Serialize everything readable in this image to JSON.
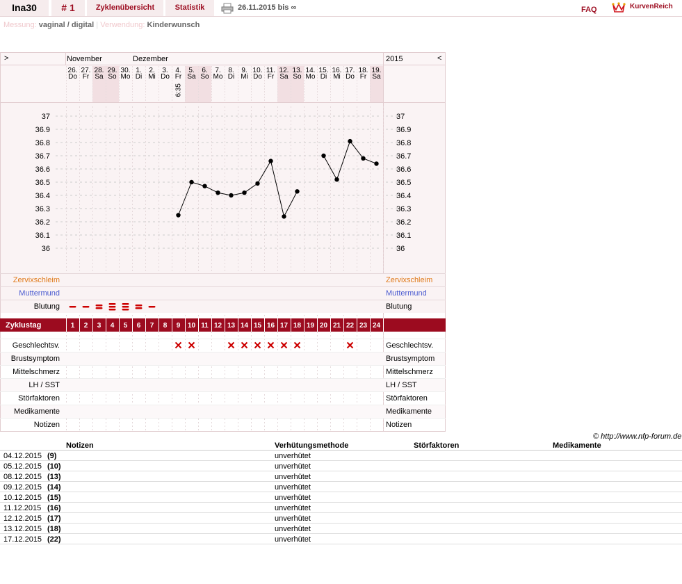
{
  "header": {
    "user": "Ina30",
    "cycle_number": "# 1",
    "tab_cycles": "Zyklenübersicht",
    "tab_stats": "Statistik",
    "date_range": "26.11.2015 bis ∞",
    "faq": "FAQ",
    "brand": "KurvenReich",
    "print_icon": "printer-icon",
    "logo_icon": "crown-logo-icon"
  },
  "meta": {
    "measure_label": "Messung:",
    "measure_value": "vaginal / digital",
    "sep": "|",
    "use_label": "Verwendung:",
    "use_value": "Kinderwunsch"
  },
  "colors": {
    "accent": "#9c0b1f",
    "weekend": "#f2dfe2",
    "cervix_label": "#e07a1a",
    "muttermund_label": "#4a5bd0",
    "bleed": "#cc0000",
    "cross": "#cc0000"
  },
  "chart_data": {
    "type": "line",
    "nav_prev": ">",
    "nav_next": "<",
    "year": "2015",
    "month_labels": [
      {
        "label": "November",
        "at_day": 0
      },
      {
        "label": "Dezember",
        "at_day": 5
      }
    ],
    "days": [
      {
        "d": "26.",
        "w": "Do",
        "we": false
      },
      {
        "d": "27.",
        "w": "Fr",
        "we": false
      },
      {
        "d": "28.",
        "w": "Sa",
        "we": true
      },
      {
        "d": "29.",
        "w": "So",
        "we": true
      },
      {
        "d": "30.",
        "w": "Mo",
        "we": false
      },
      {
        "d": "1.",
        "w": "Di",
        "we": false
      },
      {
        "d": "2.",
        "w": "Mi",
        "we": false
      },
      {
        "d": "3.",
        "w": "Do",
        "we": false
      },
      {
        "d": "4.",
        "w": "Fr",
        "we": false
      },
      {
        "d": "5.",
        "w": "Sa",
        "we": true
      },
      {
        "d": "6.",
        "w": "So",
        "we": true
      },
      {
        "d": "7.",
        "w": "Mo",
        "we": false
      },
      {
        "d": "8.",
        "w": "Di",
        "we": false
      },
      {
        "d": "9.",
        "w": "Mi",
        "we": false
      },
      {
        "d": "10.",
        "w": "Do",
        "we": false
      },
      {
        "d": "11.",
        "w": "Fr",
        "we": false
      },
      {
        "d": "12.",
        "w": "Sa",
        "we": true
      },
      {
        "d": "13.",
        "w": "So",
        "we": true
      },
      {
        "d": "14.",
        "w": "Mo",
        "we": false
      },
      {
        "d": "15.",
        "w": "Di",
        "we": false
      },
      {
        "d": "16.",
        "w": "Mi",
        "we": false
      },
      {
        "d": "17.",
        "w": "Do",
        "we": false
      },
      {
        "d": "18.",
        "w": "Fr",
        "we": false
      },
      {
        "d": "19.",
        "w": "Sa",
        "we": true
      }
    ],
    "time_label": {
      "day_index": 8,
      "text": "6:35"
    },
    "ylim": [
      36.0,
      37.0
    ],
    "yticks": [
      "37",
      "36.9",
      "36.8",
      "36.7",
      "36.6",
      "36.5",
      "36.4",
      "36.3",
      "36.2",
      "36.1",
      "36"
    ],
    "temperatures": [
      null,
      null,
      null,
      null,
      null,
      null,
      null,
      null,
      36.25,
      36.5,
      36.47,
      36.42,
      36.4,
      36.42,
      36.49,
      36.66,
      36.24,
      36.43,
      null,
      36.7,
      36.52,
      36.81,
      36.68,
      36.64
    ],
    "rows_top": [
      "Zervixschleim",
      "Muttermund",
      "Blutung"
    ],
    "bleeding": [
      1,
      1,
      2,
      3,
      3,
      2,
      1,
      0,
      0,
      0,
      0,
      0,
      0,
      0,
      0,
      0,
      0,
      0,
      0,
      0,
      0,
      0,
      0,
      0
    ],
    "cycle_label": "Zyklustag",
    "cycle_days": [
      "1",
      "2",
      "3",
      "4",
      "5",
      "6",
      "7",
      "8",
      "9",
      "10",
      "11",
      "12",
      "13",
      "14",
      "15",
      "16",
      "17",
      "18",
      "19",
      "20",
      "21",
      "22",
      "23",
      "24"
    ],
    "rows_bottom": [
      "Geschlechtsv.",
      "Brustsymptom",
      "Mittelschmerz",
      "LH / SST",
      "Störfaktoren",
      "Medikamente",
      "Notizen"
    ],
    "intercourse": [
      false,
      false,
      false,
      false,
      false,
      false,
      false,
      false,
      true,
      true,
      false,
      false,
      true,
      true,
      true,
      true,
      true,
      true,
      false,
      false,
      false,
      true,
      false,
      false
    ]
  },
  "copyright": "© http://www.nfp-forum.de",
  "notes_table": {
    "headers": [
      "Notizen",
      "Verhütungsmethode",
      "Störfaktoren",
      "Medikamente"
    ],
    "rows": [
      {
        "date": "04.12.2015",
        "day": "(9)",
        "method": "unverhütet"
      },
      {
        "date": "05.12.2015",
        "day": "(10)",
        "method": "unverhütet"
      },
      {
        "date": "08.12.2015",
        "day": "(13)",
        "method": "unverhütet"
      },
      {
        "date": "09.12.2015",
        "day": "(14)",
        "method": "unverhütet"
      },
      {
        "date": "10.12.2015",
        "day": "(15)",
        "method": "unverhütet"
      },
      {
        "date": "11.12.2015",
        "day": "(16)",
        "method": "unverhütet"
      },
      {
        "date": "12.12.2015",
        "day": "(17)",
        "method": "unverhütet"
      },
      {
        "date": "13.12.2015",
        "day": "(18)",
        "method": "unverhütet"
      },
      {
        "date": "17.12.2015",
        "day": "(22)",
        "method": "unverhütet"
      }
    ]
  }
}
